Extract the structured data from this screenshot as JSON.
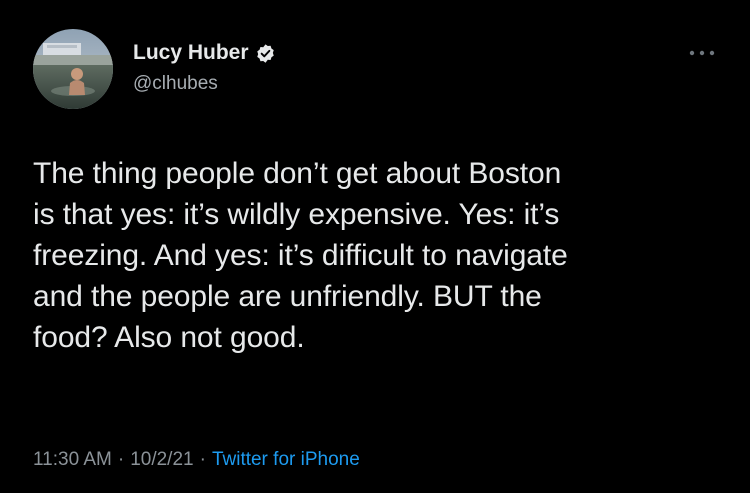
{
  "user": {
    "display_name": "Lucy Huber",
    "handle": "@clhubes",
    "verified": true
  },
  "tweet": {
    "text": "The thing people don’t get about Boston\nis that yes: it’s wildly expensive. Yes: it’s\nfreezing. And yes: it’s difficult to navigate\nand the people are unfriendly. BUT the\nfood? Also not good."
  },
  "meta": {
    "time": "11:30 AM",
    "separator": "·",
    "date": "10/2/21",
    "source": "Twitter for iPhone"
  },
  "icons": {
    "verified": "verified-badge-icon",
    "more": "more-options-icon"
  },
  "colors": {
    "background": "#000000",
    "text_primary": "#e7e9ea",
    "text_secondary": "#8b9298",
    "accent": "#1d9bf0"
  }
}
